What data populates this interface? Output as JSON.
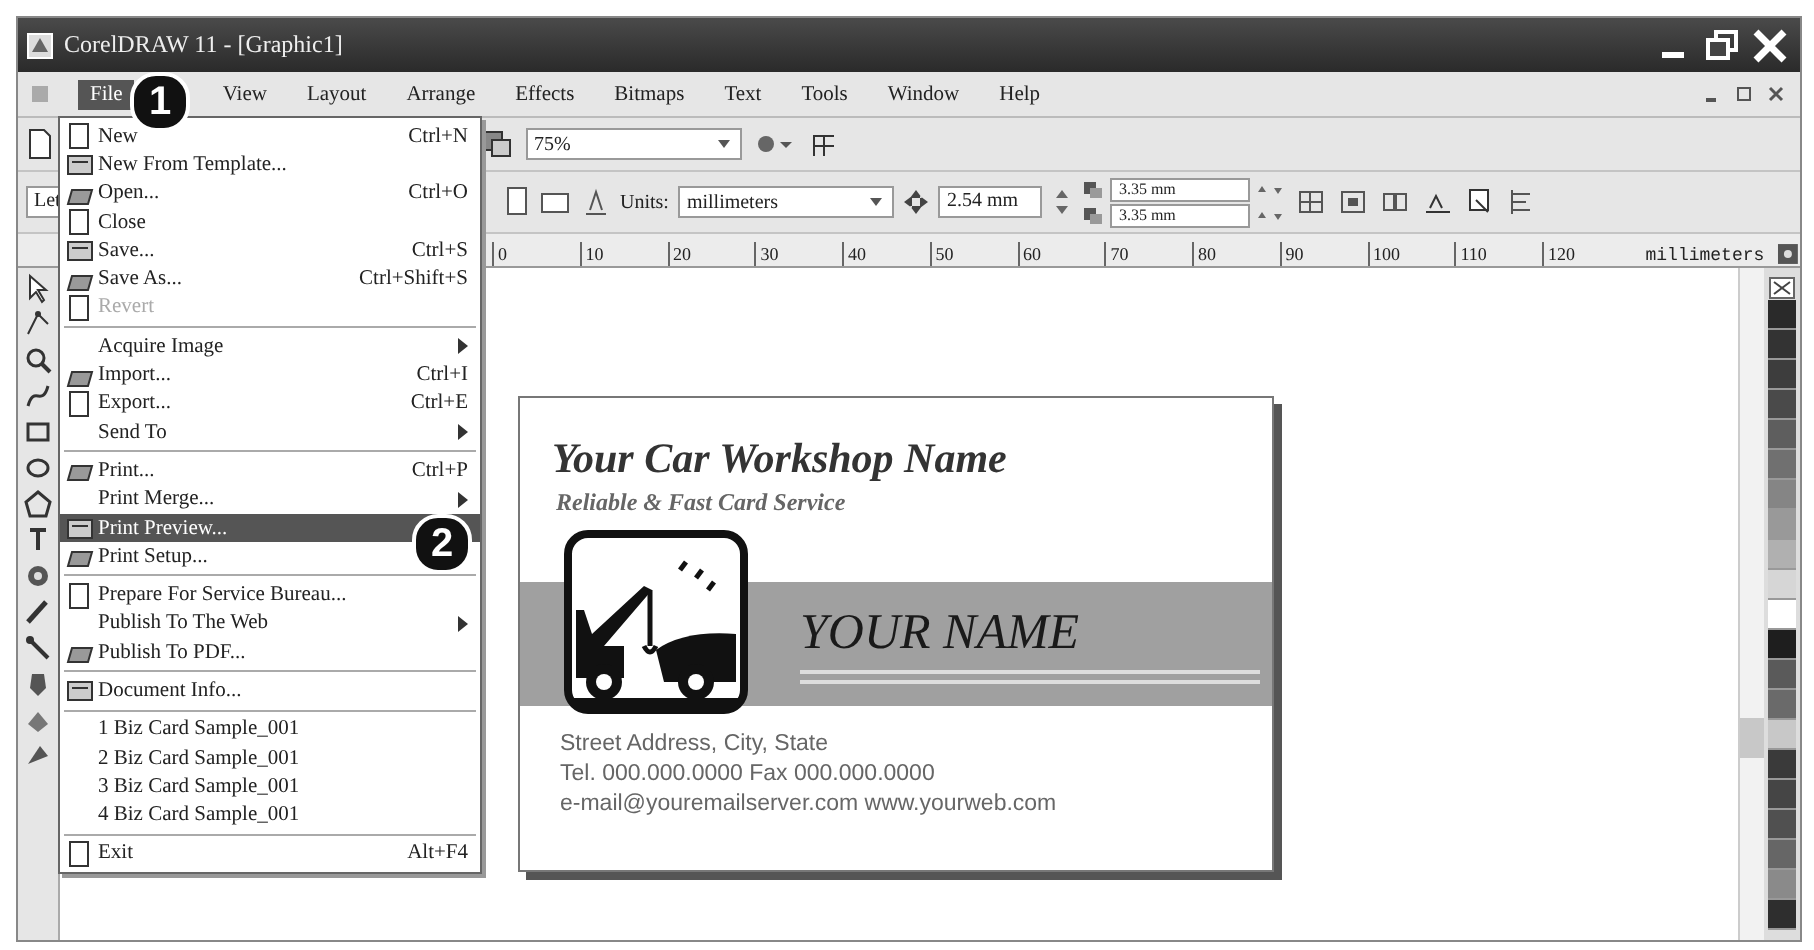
{
  "window": {
    "title": "CorelDRAW 11 - [Graphic1]"
  },
  "menu_bar": [
    {
      "label": "File",
      "selected": true
    },
    {
      "label": "View",
      "selected": false
    },
    {
      "label": "Layout",
      "selected": false
    },
    {
      "label": "Arrange",
      "selected": false
    },
    {
      "label": "Effects",
      "selected": false
    },
    {
      "label": "Bitmaps",
      "selected": false
    },
    {
      "label": "Text",
      "selected": false
    },
    {
      "label": "Tools",
      "selected": false
    },
    {
      "label": "Window",
      "selected": false
    },
    {
      "label": "Help",
      "selected": false
    }
  ],
  "callouts": [
    "1",
    "2"
  ],
  "toolbar": {
    "zoom": "75%"
  },
  "property_bar": {
    "paper": "Let",
    "units_label": "Units:",
    "units": "millimeters",
    "nudge": "2.54 mm",
    "duplicate_x": "3.35 mm",
    "duplicate_y": "3.35 mm"
  },
  "ruler": {
    "ticks": [
      "0",
      "10",
      "20",
      "30",
      "40",
      "50",
      "60",
      "70",
      "80",
      "90",
      "100",
      "110",
      "120"
    ],
    "unit": "millimeters"
  },
  "file_menu": {
    "groups": [
      [
        {
          "label": "New",
          "shortcut": "Ctrl+N",
          "icon": true,
          "submenu": false,
          "disabled": false,
          "selected": false
        },
        {
          "label": "New From Template...",
          "icon": true,
          "submenu": false,
          "disabled": false,
          "selected": false
        },
        {
          "label": "Open...",
          "shortcut": "Ctrl+O",
          "icon": true,
          "submenu": false,
          "disabled": false,
          "selected": false
        },
        {
          "label": "Close",
          "icon": true,
          "submenu": false,
          "disabled": false,
          "selected": false
        },
        {
          "label": "Save...",
          "shortcut": "Ctrl+S",
          "icon": true,
          "submenu": false,
          "disabled": false,
          "selected": false
        },
        {
          "label": "Save As...",
          "shortcut": "Ctrl+Shift+S",
          "icon": true,
          "submenu": false,
          "disabled": false,
          "selected": false
        },
        {
          "label": "Revert",
          "icon": true,
          "submenu": false,
          "disabled": true,
          "selected": false
        }
      ],
      [
        {
          "label": "Acquire Image",
          "icon": false,
          "submenu": true,
          "disabled": false,
          "selected": false
        },
        {
          "label": "Import...",
          "shortcut": "Ctrl+I",
          "icon": true,
          "submenu": false,
          "disabled": false,
          "selected": false
        },
        {
          "label": "Export...",
          "shortcut": "Ctrl+E",
          "icon": true,
          "submenu": false,
          "disabled": false,
          "selected": false
        },
        {
          "label": "Send To",
          "icon": false,
          "submenu": true,
          "disabled": false,
          "selected": false
        }
      ],
      [
        {
          "label": "Print...",
          "shortcut": "Ctrl+P",
          "icon": true,
          "submenu": false,
          "disabled": false,
          "selected": false
        },
        {
          "label": "Print Merge...",
          "icon": false,
          "submenu": true,
          "disabled": false,
          "selected": false
        },
        {
          "label": "Print Preview...",
          "icon": true,
          "submenu": false,
          "disabled": false,
          "selected": true
        },
        {
          "label": "Print Setup...",
          "icon": true,
          "submenu": false,
          "disabled": false,
          "selected": false
        }
      ],
      [
        {
          "label": "Prepare For Service Bureau...",
          "icon": true,
          "submenu": false,
          "disabled": false,
          "selected": false
        },
        {
          "label": "Publish To The Web",
          "icon": false,
          "submenu": true,
          "disabled": false,
          "selected": false
        },
        {
          "label": "Publish To PDF...",
          "icon": true,
          "submenu": false,
          "disabled": false,
          "selected": false
        }
      ],
      [
        {
          "label": "Document Info...",
          "icon": true,
          "submenu": false,
          "disabled": false,
          "selected": false
        }
      ],
      [
        {
          "label": "1 Biz Card Sample_001",
          "icon": false,
          "submenu": false,
          "disabled": false,
          "selected": false
        },
        {
          "label": "2 Biz Card Sample_001",
          "icon": false,
          "submenu": false,
          "disabled": false,
          "selected": false
        },
        {
          "label": "3 Biz Card Sample_001",
          "icon": false,
          "submenu": false,
          "disabled": false,
          "selected": false
        },
        {
          "label": "4 Biz Card Sample_001",
          "icon": false,
          "submenu": false,
          "disabled": false,
          "selected": false
        }
      ],
      [
        {
          "label": "Exit",
          "shortcut": "Alt+F4",
          "icon": true,
          "submenu": false,
          "disabled": false,
          "selected": false
        }
      ]
    ]
  },
  "card": {
    "title": "Your Car Workshop Name",
    "tagline": "Reliable & Fast Card Service",
    "name": "YOUR NAME",
    "lines": [
      "Street Address, City, State",
      "Tel. 000.000.0000   Fax 000.000.0000",
      "e-mail@youremailserver.com   www.yourweb.com"
    ]
  },
  "palette": [
    {
      "color": "#2a2a2a"
    },
    {
      "color": "#333333"
    },
    {
      "color": "#3d3d3d"
    },
    {
      "color": "#4a4a4a"
    },
    {
      "color": "#5e5e5e"
    },
    {
      "color": "#707070"
    },
    {
      "color": "#858585"
    },
    {
      "color": "#999999"
    },
    {
      "color": "#b0b0b0"
    },
    {
      "color": "#d6d6d6"
    },
    {
      "color": "#ffffff"
    },
    {
      "color": "#1e1e1e"
    },
    {
      "color": "#5a5a5a"
    },
    {
      "color": "#6a6a6a"
    },
    {
      "color": "#c8c8c8"
    },
    {
      "color": "#3a3a3a"
    },
    {
      "color": "#454545"
    },
    {
      "color": "#505050"
    },
    {
      "color": "#666666"
    },
    {
      "color": "#8a8a8a"
    },
    {
      "color": "#2e2e2e"
    }
  ]
}
